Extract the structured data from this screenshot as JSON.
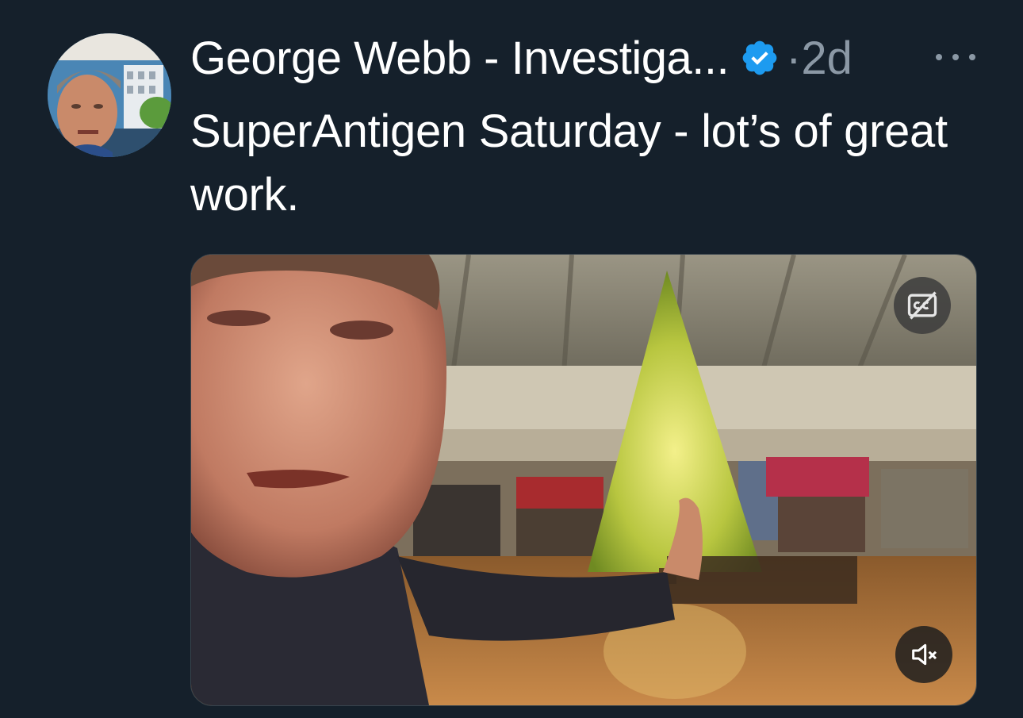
{
  "tweet": {
    "author_name": "George Webb - Investiga...",
    "separator": "·",
    "timestamp": "2d",
    "text": "SuperAntigen Saturday - lot’s of great work.",
    "avatar_icon": "profile-photo",
    "verified_icon": "verified-badge-icon",
    "more_icon": "more-options-icon"
  },
  "video": {
    "cc_icon": "captions-off-icon",
    "mute_icon": "muted-speaker-icon"
  },
  "colors": {
    "background": "#15202b",
    "primary_text": "#ffffff",
    "secondary_text": "#8b98a5",
    "verified_blue": "#1d9bf0"
  }
}
